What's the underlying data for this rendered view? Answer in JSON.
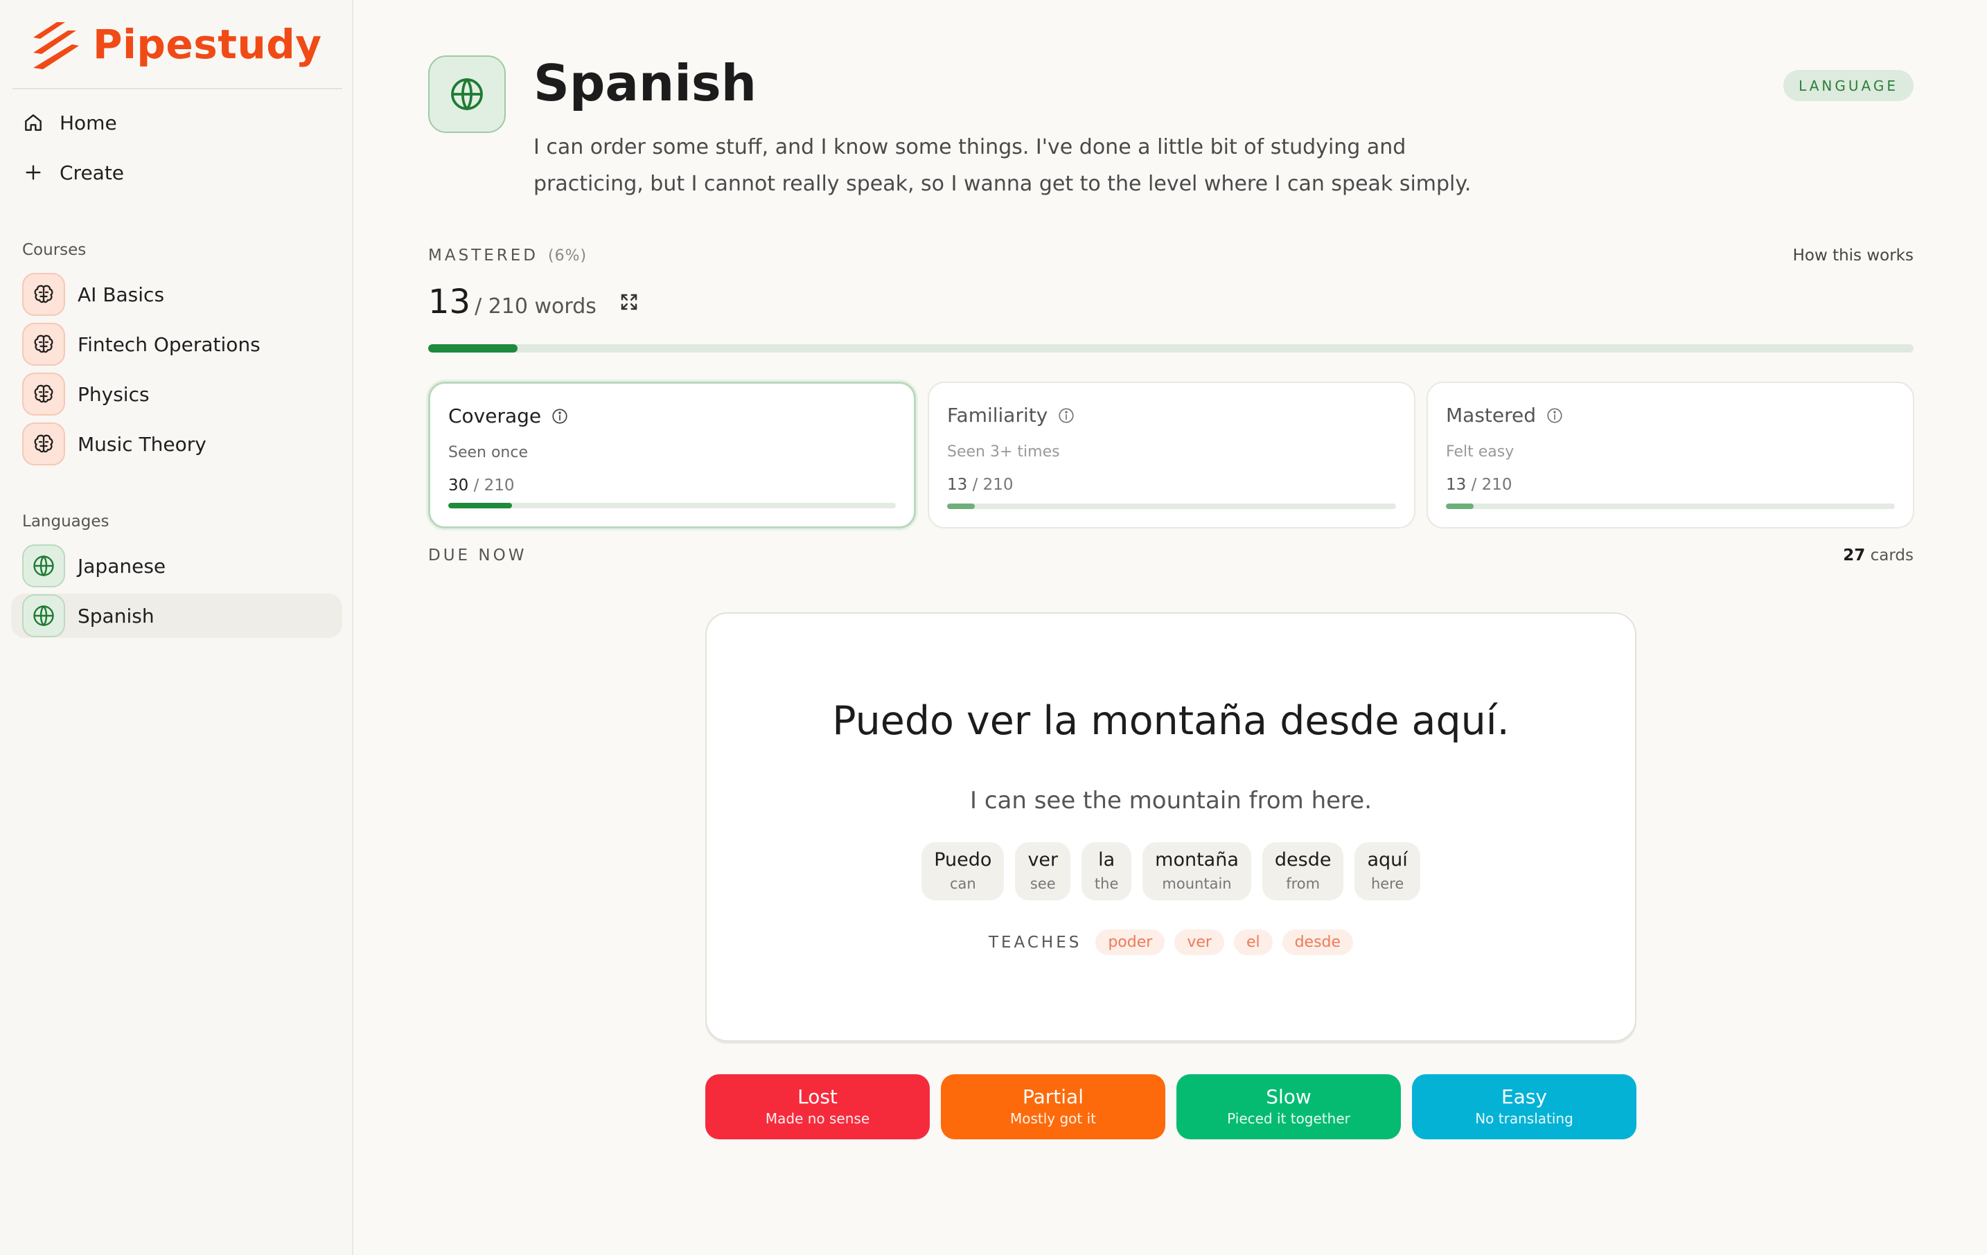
{
  "app": {
    "name": "Pipestudy",
    "brand_color": "#f04a16"
  },
  "sidebar": {
    "nav": [
      {
        "label": "Home",
        "icon": "home-icon"
      },
      {
        "label": "Create",
        "icon": "plus-icon"
      }
    ],
    "courses_label": "Courses",
    "courses": [
      {
        "label": "AI Basics",
        "icon": "brain-icon"
      },
      {
        "label": "Fintech Operations",
        "icon": "brain-icon"
      },
      {
        "label": "Physics",
        "icon": "brain-icon"
      },
      {
        "label": "Music Theory",
        "icon": "brain-icon"
      }
    ],
    "languages_label": "Languages",
    "languages": [
      {
        "label": "Japanese",
        "icon": "globe-icon",
        "active": false
      },
      {
        "label": "Spanish",
        "icon": "globe-icon",
        "active": true
      }
    ]
  },
  "header": {
    "title": "Spanish",
    "badge": "LANGUAGE",
    "description": "I can order some stuff, and I know some things. I've done a little bit of studying and practicing, but I cannot really speak, so I wanna get to the level where I can speak simply."
  },
  "progress": {
    "label": "MASTERED",
    "percent_label": "(6%)",
    "how_link": "How this works",
    "count": "13",
    "total_label": "/ 210 words",
    "fraction": 0.06
  },
  "stats": [
    {
      "title": "Coverage",
      "subtitle": "Seen once",
      "count": "30",
      "total": "/ 210",
      "fraction": 0.143,
      "selected": true
    },
    {
      "title": "Familiarity",
      "subtitle": "Seen 3+ times",
      "count": "13",
      "total": "/ 210",
      "fraction": 0.062,
      "selected": false
    },
    {
      "title": "Mastered",
      "subtitle": "Felt easy",
      "count": "13",
      "total": "/ 210",
      "fraction": 0.062,
      "selected": false
    }
  ],
  "due": {
    "label": "DUE NOW",
    "count": "27",
    "unit": "cards"
  },
  "card": {
    "sentence": "Puedo ver la montaña desde aquí.",
    "translation": "I can see the mountain from here.",
    "words": [
      {
        "es": "Puedo",
        "en": "can"
      },
      {
        "es": "ver",
        "en": "see"
      },
      {
        "es": "la",
        "en": "the"
      },
      {
        "es": "montaña",
        "en": "mountain"
      },
      {
        "es": "desde",
        "en": "from"
      },
      {
        "es": "aquí",
        "en": "here"
      }
    ],
    "teaches_label": "TEACHES",
    "teaches": [
      "poder",
      "ver",
      "el",
      "desde"
    ]
  },
  "ratings": [
    {
      "label": "Lost",
      "sub": "Made no sense",
      "color": "#f52b3c"
    },
    {
      "label": "Partial",
      "sub": "Mostly got it",
      "color": "#fd6a0b"
    },
    {
      "label": "Slow",
      "sub": "Pieced it together",
      "color": "#05bb72"
    },
    {
      "label": "Easy",
      "sub": "No translating",
      "color": "#04b2d6"
    }
  ]
}
